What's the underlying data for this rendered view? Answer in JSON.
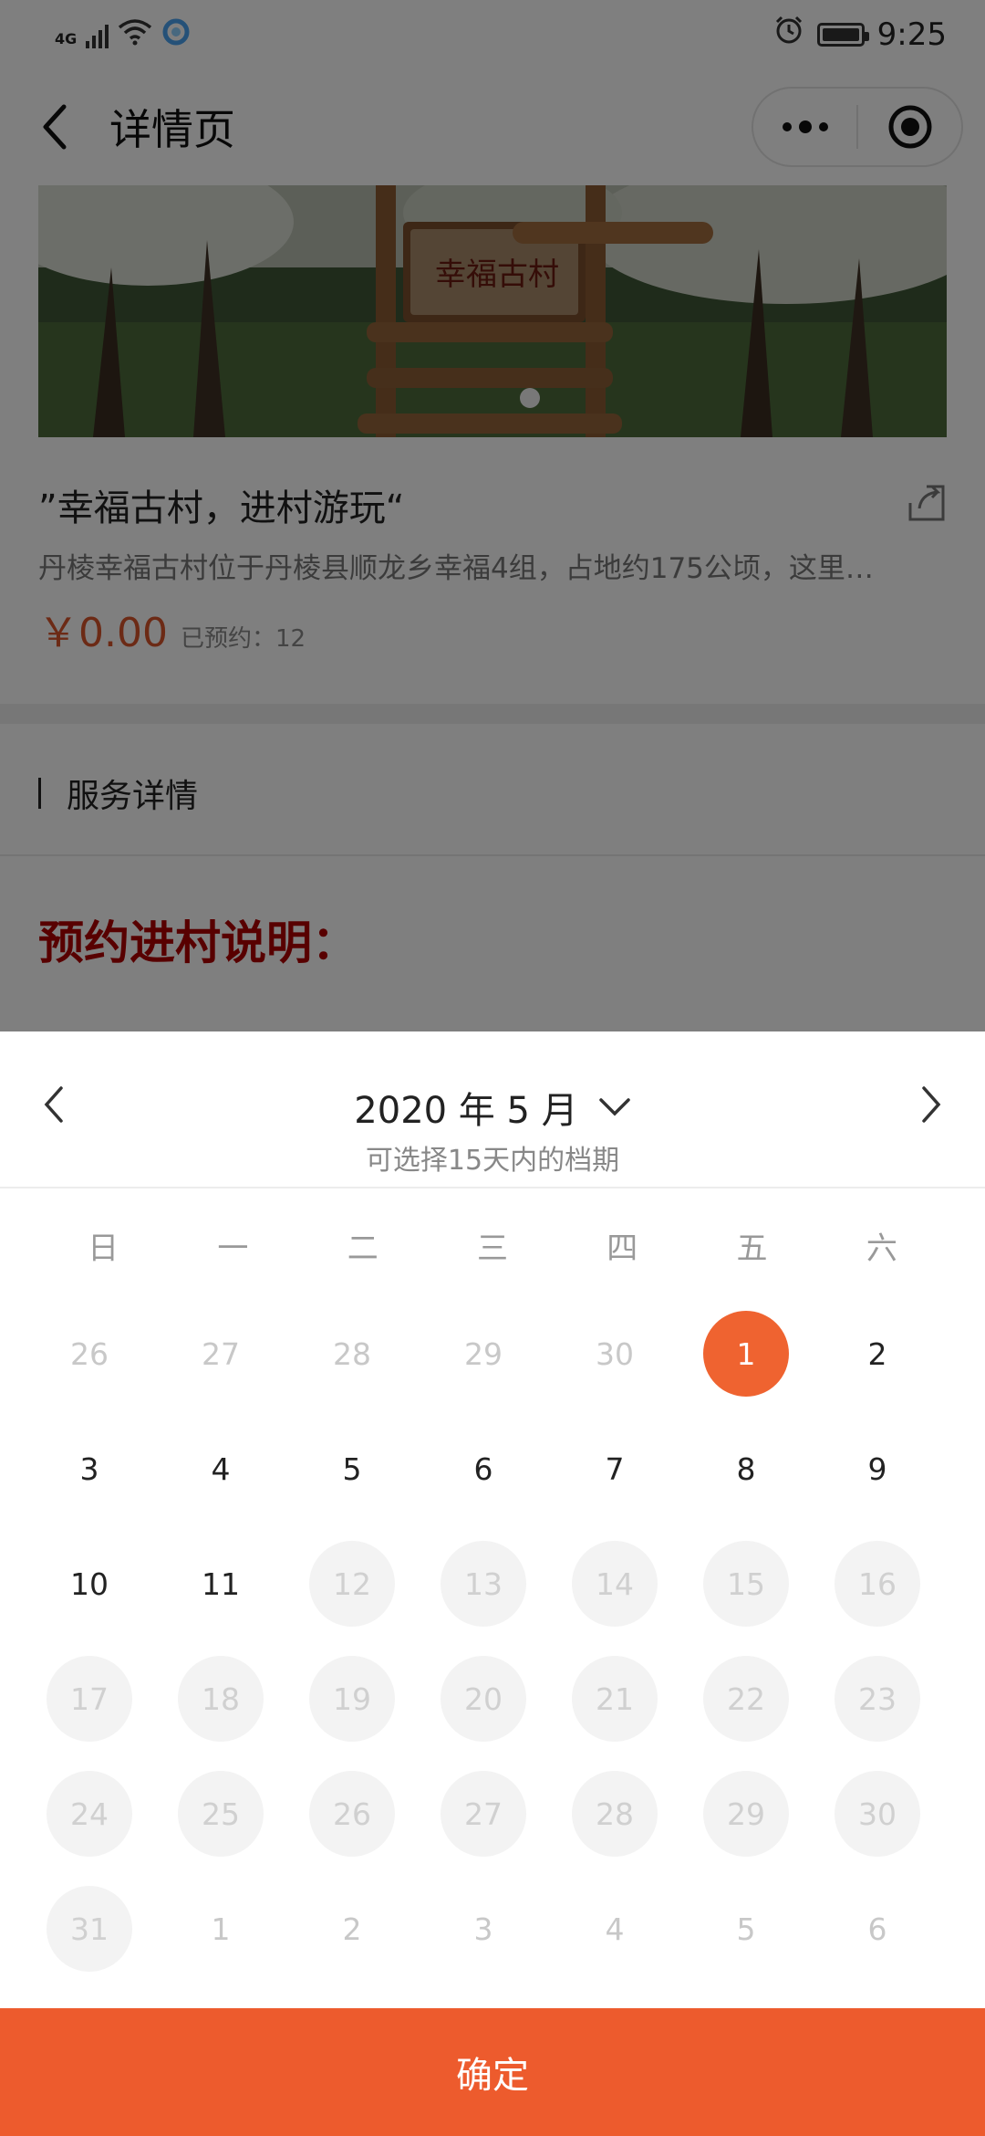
{
  "status_bar": {
    "network": "4G",
    "time": "9:25",
    "icons": [
      "signal-icon",
      "wifi-icon",
      "app-notification-icon",
      "alarm-icon",
      "battery-icon"
    ]
  },
  "nav": {
    "title": "详情页",
    "icons": [
      "back-arrow-icon",
      "more-icon",
      "target-icon"
    ]
  },
  "item": {
    "sign_text": "幸福古村",
    "title": "”幸福古村，进村游玩“",
    "description": "丹棱幸福古村位于丹棱县顺龙乡幸福4组，占地约175公顷，这里…",
    "price": "￥0.00",
    "booked": "已预约：12",
    "share_icon": "share-icon"
  },
  "section": {
    "title": "服务详情",
    "notice_heading": "预约进村说明："
  },
  "calendar": {
    "month_label": "2020 年 5 月",
    "hint": "可选择15天内的档期",
    "weekdays": [
      "日",
      "一",
      "二",
      "三",
      "四",
      "五",
      "六"
    ],
    "days": [
      {
        "label": "26",
        "state": "other"
      },
      {
        "label": "27",
        "state": "other"
      },
      {
        "label": "28",
        "state": "other"
      },
      {
        "label": "29",
        "state": "other"
      },
      {
        "label": "30",
        "state": "other"
      },
      {
        "label": "1",
        "state": "selected"
      },
      {
        "label": "2",
        "state": "available"
      },
      {
        "label": "3",
        "state": "available"
      },
      {
        "label": "4",
        "state": "available"
      },
      {
        "label": "5",
        "state": "available"
      },
      {
        "label": "6",
        "state": "available"
      },
      {
        "label": "7",
        "state": "available"
      },
      {
        "label": "8",
        "state": "available"
      },
      {
        "label": "9",
        "state": "available"
      },
      {
        "label": "10",
        "state": "available"
      },
      {
        "label": "11",
        "state": "available"
      },
      {
        "label": "12",
        "state": "disabled"
      },
      {
        "label": "13",
        "state": "disabled"
      },
      {
        "label": "14",
        "state": "disabled"
      },
      {
        "label": "15",
        "state": "disabled"
      },
      {
        "label": "16",
        "state": "disabled"
      },
      {
        "label": "17",
        "state": "disabled"
      },
      {
        "label": "18",
        "state": "disabled"
      },
      {
        "label": "19",
        "state": "disabled"
      },
      {
        "label": "20",
        "state": "disabled"
      },
      {
        "label": "21",
        "state": "disabled"
      },
      {
        "label": "22",
        "state": "disabled"
      },
      {
        "label": "23",
        "state": "disabled"
      },
      {
        "label": "24",
        "state": "disabled"
      },
      {
        "label": "25",
        "state": "disabled"
      },
      {
        "label": "26",
        "state": "disabled"
      },
      {
        "label": "27",
        "state": "disabled"
      },
      {
        "label": "28",
        "state": "disabled"
      },
      {
        "label": "29",
        "state": "disabled"
      },
      {
        "label": "30",
        "state": "disabled"
      },
      {
        "label": "31",
        "state": "disabled"
      },
      {
        "label": "1",
        "state": "other"
      },
      {
        "label": "2",
        "state": "other"
      },
      {
        "label": "3",
        "state": "other"
      },
      {
        "label": "4",
        "state": "other"
      },
      {
        "label": "5",
        "state": "other"
      },
      {
        "label": "6",
        "state": "other"
      }
    ],
    "confirm_label": "确定"
  },
  "colors": {
    "accent": "#ed5b2d",
    "selected_day": "#ef6330",
    "price": "#d9542a",
    "notice_heading": "#b00000"
  }
}
